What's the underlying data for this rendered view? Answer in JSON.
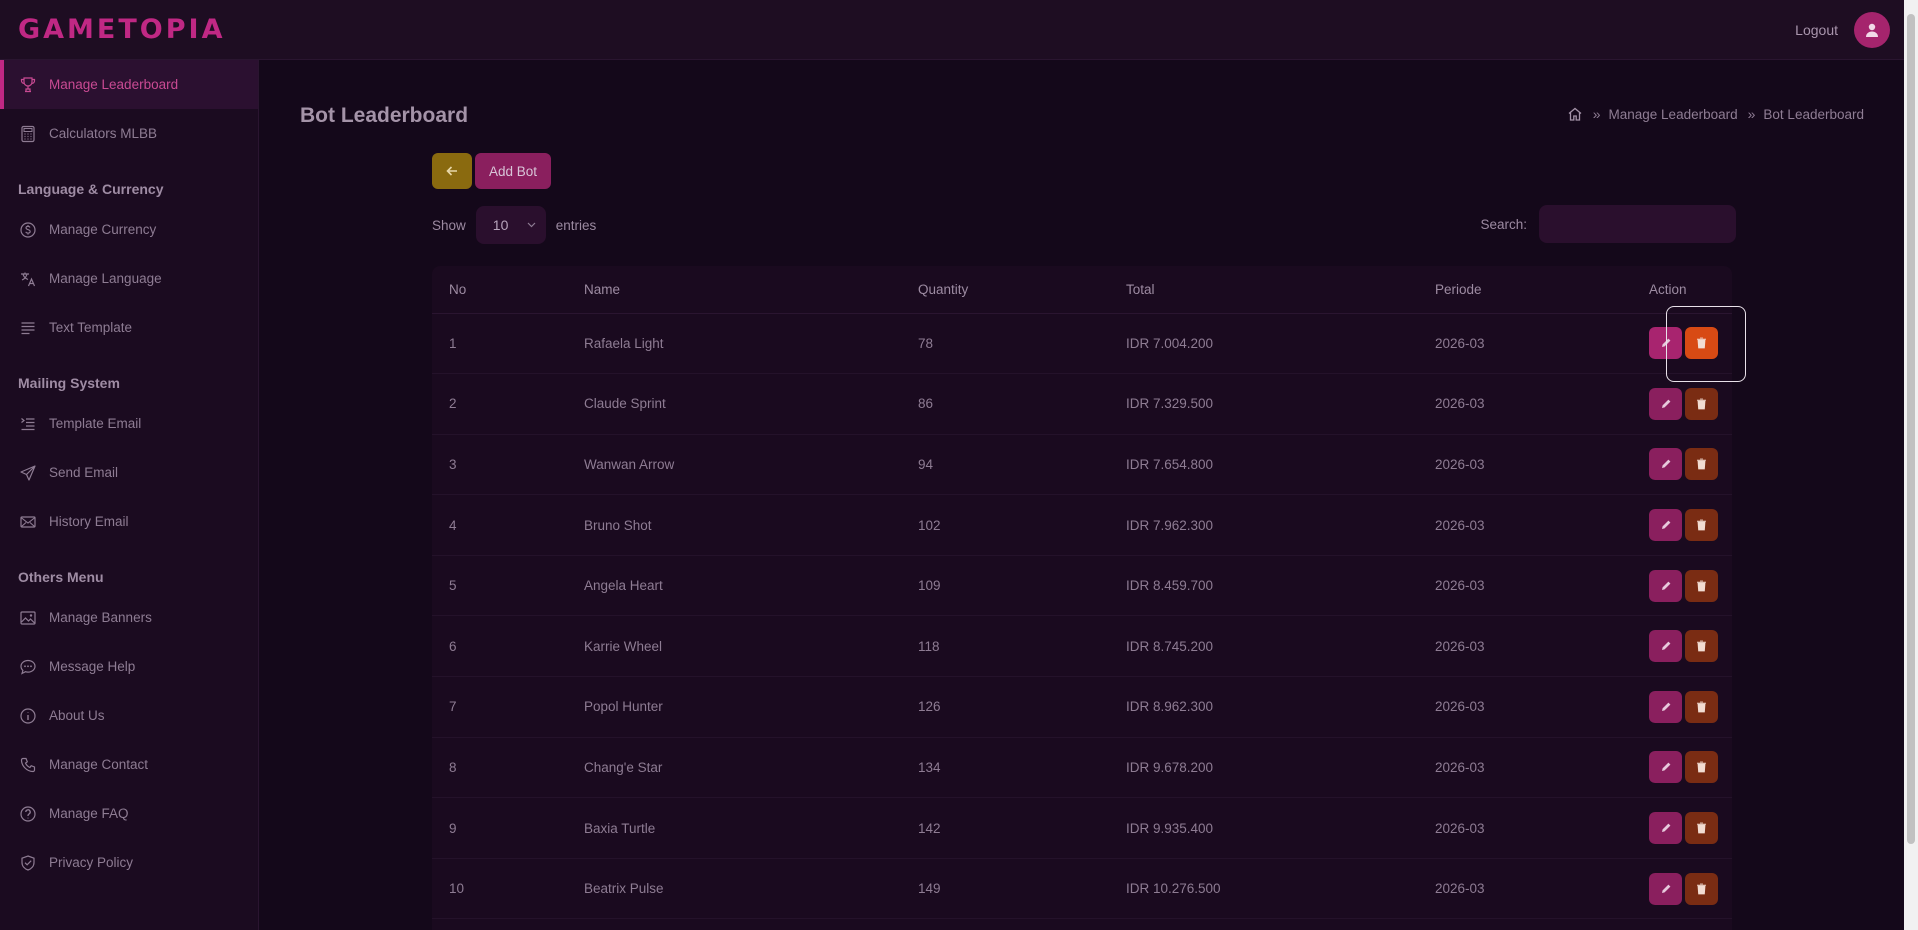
{
  "header": {
    "brand": "GAMETOPIA",
    "logout_label": "Logout"
  },
  "sidebar": {
    "items_top": [
      {
        "label": "Manage Leaderboard",
        "icon": "trophy-icon",
        "active": true
      },
      {
        "label": "Calculators MLBB",
        "icon": "calculator-icon"
      }
    ],
    "section_language": "Language & Currency",
    "items_language": [
      {
        "label": "Manage Currency",
        "icon": "dollar-icon"
      },
      {
        "label": "Manage Language",
        "icon": "translate-icon"
      },
      {
        "label": "Text Template",
        "icon": "text-lines-icon"
      }
    ],
    "section_mailing": "Mailing System",
    "items_mailing": [
      {
        "label": "Template Email",
        "icon": "list-indent-icon"
      },
      {
        "label": "Send Email",
        "icon": "send-icon"
      },
      {
        "label": "History Email",
        "icon": "mail-icon"
      }
    ],
    "section_others": "Others Menu",
    "items_others": [
      {
        "label": "Manage Banners",
        "icon": "image-icon"
      },
      {
        "label": "Message Help",
        "icon": "chat-icon"
      },
      {
        "label": "About Us",
        "icon": "info-icon"
      },
      {
        "label": "Manage Contact",
        "icon": "phone-icon"
      },
      {
        "label": "Manage FAQ",
        "icon": "question-icon"
      },
      {
        "label": "Privacy Policy",
        "icon": "shield-icon"
      }
    ]
  },
  "page": {
    "title": "Bot Leaderboard",
    "breadcrumb": [
      "Manage Leaderboard",
      "Bot Leaderboard"
    ],
    "add_button": "Add Bot",
    "show_label": "Show",
    "entries_label": "entries",
    "page_length": "10",
    "search_label": "Search:",
    "search_value": ""
  },
  "table": {
    "columns": [
      "No",
      "Name",
      "Quantity",
      "Total",
      "Periode",
      "Action"
    ],
    "rows": [
      {
        "no": "1",
        "name": "Rafaela Light",
        "quantity": "78",
        "total": "IDR 7.004.200",
        "periode": "2026-03"
      },
      {
        "no": "2",
        "name": "Claude Sprint",
        "quantity": "86",
        "total": "IDR 7.329.500",
        "periode": "2026-03"
      },
      {
        "no": "3",
        "name": "Wanwan Arrow",
        "quantity": "94",
        "total": "IDR 7.654.800",
        "periode": "2026-03"
      },
      {
        "no": "4",
        "name": "Bruno Shot",
        "quantity": "102",
        "total": "IDR 7.962.300",
        "periode": "2026-03"
      },
      {
        "no": "5",
        "name": "Angela Heart",
        "quantity": "109",
        "total": "IDR 8.459.700",
        "periode": "2026-03"
      },
      {
        "no": "6",
        "name": "Karrie Wheel",
        "quantity": "118",
        "total": "IDR 8.745.200",
        "periode": "2026-03"
      },
      {
        "no": "7",
        "name": "Popol Hunter",
        "quantity": "126",
        "total": "IDR 8.962.300",
        "periode": "2026-03"
      },
      {
        "no": "8",
        "name": "Chang'e Star",
        "quantity": "134",
        "total": "IDR 9.678.200",
        "periode": "2026-03"
      },
      {
        "no": "9",
        "name": "Baxia Turtle",
        "quantity": "142",
        "total": "IDR 9.935.400",
        "periode": "2026-03"
      },
      {
        "no": "10",
        "name": "Beatrix Pulse",
        "quantity": "149",
        "total": "IDR 10.276.500",
        "periode": "2026-03"
      }
    ]
  },
  "colors": {
    "accent": "#c02884",
    "back_button": "#8a6a0f",
    "delete": "#7a2c13",
    "delete_hover": "#d84a14",
    "background": "#14081a"
  }
}
